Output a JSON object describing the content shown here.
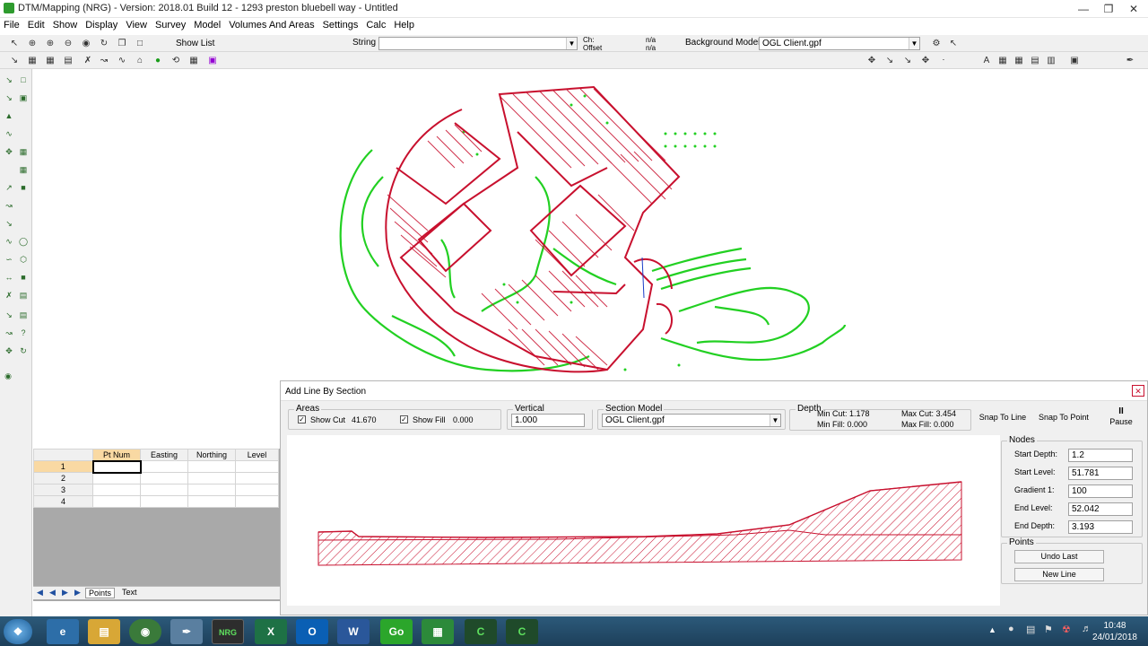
{
  "window": {
    "title": "DTM/Mapping (NRG) - Version: 2018.01 Build 12 - 1293 preston bluebell way - Untitled"
  },
  "menu": [
    "File",
    "Edit",
    "Show",
    "Display",
    "View",
    "Survey",
    "Model",
    "Volumes And Areas",
    "Settings",
    "Calc",
    "Help"
  ],
  "toolbar": {
    "show_list": "Show List",
    "string_label": "String",
    "string_value": "",
    "ch_label": "Ch:",
    "offset_label": "Offset",
    "ch_value": "n/a",
    "offset_value": "n/a",
    "background_model_label": "Background Model:",
    "background_model_value": "OGL Client.gpf"
  },
  "grid": {
    "columns": [
      "Pt Num",
      "Easting",
      "Northing",
      "Level"
    ],
    "rows": [
      "1",
      "2",
      "3",
      "4"
    ],
    "tabs": [
      "Points",
      "Text"
    ]
  },
  "dialog": {
    "title": "Add Line By Section",
    "areas": {
      "label": "Areas",
      "show_cut_label": "Show Cut",
      "show_cut_value": "41.670",
      "show_fill_label": "Show Fill",
      "show_fill_value": "0.000"
    },
    "vertical_exaggeration": {
      "label": "Vertical Exageration",
      "value": "1.000"
    },
    "section_model": {
      "label": "Section Model",
      "value": "OGL Client.gpf"
    },
    "depth": {
      "label": "Depth",
      "min_cut": "Min Cut: 1.178",
      "min_fill": "Min Fill: 0.000",
      "max_cut": "Max Cut: 3.454",
      "max_fill": "Max Fill: 0.000"
    },
    "snap_to_line": "Snap To Line",
    "snap_to_point": "Snap To Point",
    "pause": "Pause",
    "nodes": {
      "label": "Nodes",
      "start_depth_label": "Start Depth:",
      "start_depth_value": "1.2",
      "start_level_label": "Start Level:",
      "start_level_value": "51.781",
      "gradient_label": "Gradient 1:",
      "gradient_value": "100",
      "end_level_label": "End Level:",
      "end_level_value": "52.042",
      "end_depth_label": "End Depth:",
      "end_depth_value": "3.193"
    },
    "points": {
      "label": "Points",
      "undo_last": "Undo Last",
      "new_line": "New Line"
    }
  },
  "taskbar": {
    "apps": [
      "Start",
      "Internet Explorer",
      "File Explorer",
      "Chrome",
      "Paint",
      "NRG",
      "Excel",
      "Outlook",
      "Word",
      "Go",
      "Project",
      "Camtasia",
      "Camtasia Recorder"
    ],
    "time": "10:48",
    "date": "24/01/2018"
  },
  "colors": {
    "cut": "#c8102e",
    "survey": "#22d022",
    "accent": "#2c5a7a"
  }
}
